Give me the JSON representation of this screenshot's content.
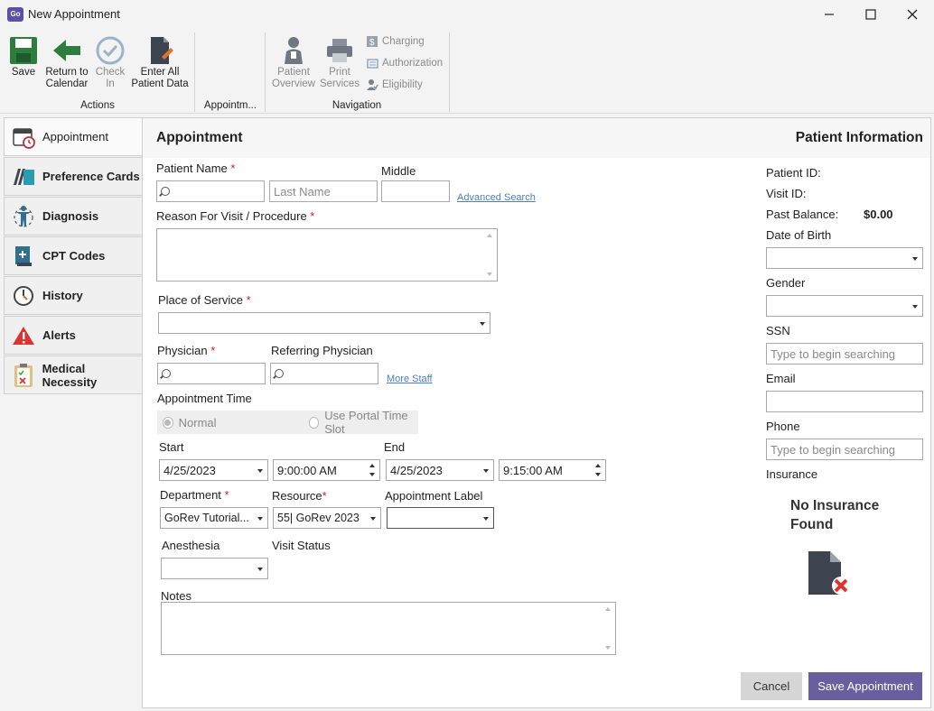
{
  "window": {
    "title": "New Appointment",
    "app_icon_text": "GoRev"
  },
  "ribbon": {
    "groups": {
      "actions": "Actions",
      "appointment": "Appointm...",
      "navigation": "Navigation"
    },
    "save": "Save",
    "return_line1": "Return to",
    "return_line2": "Calendar",
    "checkin_line1": "Check",
    "checkin_line2": "In",
    "enter_line1": "Enter All",
    "enter_line2": "Patient Data",
    "overview_line1": "Patient",
    "overview_line2": "Overview",
    "print_line1": "Print",
    "print_line2": "Services",
    "charging": "Charging",
    "authorization": "Authorization",
    "eligibility": "Eligibility"
  },
  "sidenav": {
    "items": [
      {
        "label": "Appointment",
        "icon": "calendar-icon"
      },
      {
        "label": "Preference Cards",
        "icon": "cards-icon"
      },
      {
        "label": "Diagnosis",
        "icon": "body-icon"
      },
      {
        "label": "CPT Codes",
        "icon": "book-icon"
      },
      {
        "label": "History",
        "icon": "clock-icon"
      },
      {
        "label": "Alerts",
        "icon": "alert-icon"
      },
      {
        "label": "Medical Necessity",
        "icon": "clipboard-icon"
      }
    ]
  },
  "form": {
    "section_title": "Appointment",
    "patient_name_label": "Patient Name",
    "middle_label": "Middle",
    "last_name_placeholder": "Last Name",
    "advanced_search": "Advanced Search",
    "reason_label": "Reason For Visit / Procedure",
    "place_of_service_label": "Place of Service",
    "physician_label": "Physician",
    "referring_physician_label": "Referring Physician",
    "more_staff": "More Staff",
    "appointment_time_label": "Appointment Time",
    "normal": "Normal",
    "use_portal": "Use Portal Time Slot",
    "start_label": "Start",
    "end_label": "End",
    "start_date": "4/25/2023",
    "start_time": "9:00:00 AM",
    "end_date": "4/25/2023",
    "end_time": "9:15:00 AM",
    "department_label": "Department",
    "department_value": "GoRev Tutorial...",
    "resource_label": "Resource",
    "resource_value": "55| GoRev 2023",
    "appointment_label_label": "Appointment Label",
    "anesthesia_label": "Anesthesia",
    "visit_status_label": "Visit Status",
    "notes_label": "Notes",
    "required_mark": "*"
  },
  "patient_info": {
    "title": "Patient Information",
    "patient_id_label": "Patient ID:",
    "visit_id_label": "Visit ID:",
    "past_balance_label": "Past Balance:",
    "past_balance_value": "$0.00",
    "dob_label": "Date of Birth",
    "gender_label": "Gender",
    "ssn_label": "SSN",
    "ssn_placeholder": "Type to begin searching",
    "email_label": "Email",
    "phone_label": "Phone",
    "phone_placeholder": "Type to begin searching",
    "insurance_label": "Insurance",
    "no_insurance_line1": "No Insurance",
    "no_insurance_line2": "Found"
  },
  "footer": {
    "cancel": "Cancel",
    "save_appointment": "Save Appointment"
  },
  "colors": {
    "accent": "#6a5f9e",
    "save_green": "#2e7d3f",
    "required_red": "#d02020",
    "link_blue": "#4a7ec2"
  }
}
